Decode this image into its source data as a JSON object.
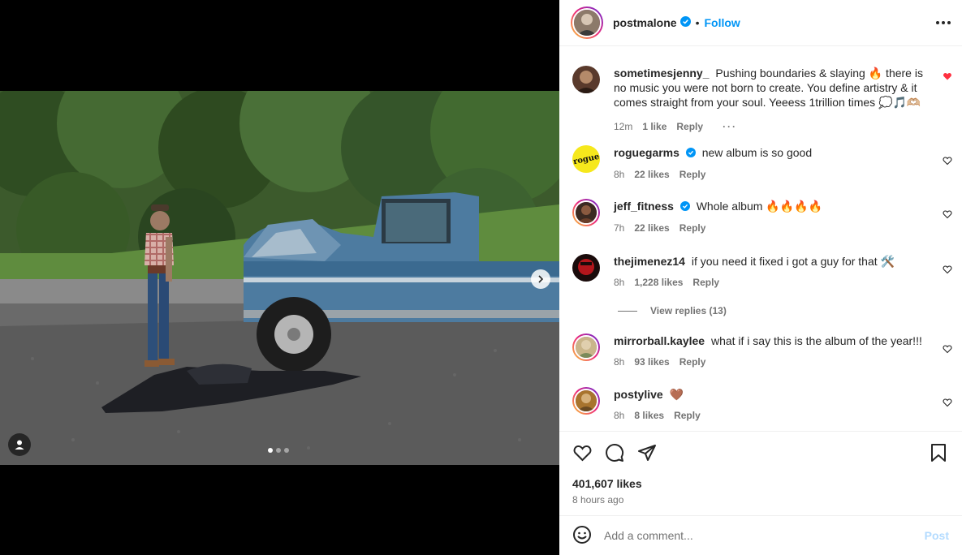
{
  "post": {
    "username": "postmalone",
    "separator": "•",
    "follow_label": "Follow",
    "carousel": {
      "slide_count": 3,
      "active_slide": 1
    }
  },
  "comments": [
    {
      "username": "sometimesjenny_",
      "text": "Pushing boundaries & slaying 🔥 there is no music you were not born to create. You define artistry & it comes straight from your soul. Yeeess 1trillion times 💭🎵🫶🏼",
      "time": "12m",
      "likes": "1 like",
      "reply_label": "Reply",
      "liked": true
    },
    {
      "username": "roguegarms",
      "verified": true,
      "text": "new album is so good",
      "time": "8h",
      "likes": "22 likes",
      "reply_label": "Reply",
      "avatar_text": "rogue"
    },
    {
      "username": "jeff_fitness",
      "verified": true,
      "text": "Whole album 🔥🔥🔥🔥",
      "time": "7h",
      "likes": "22 likes",
      "reply_label": "Reply"
    },
    {
      "username": "thejimenez14",
      "text": "if you need it fixed i got a guy for that 🛠️",
      "time": "8h",
      "likes": "1,228 likes",
      "reply_label": "Reply"
    },
    {
      "username": "mirrorball.kaylee",
      "text": "what if i say this is the album of the year!!!",
      "time": "8h",
      "likes": "93 likes",
      "reply_label": "Reply"
    },
    {
      "username": "postylive",
      "text": "🤎",
      "time": "8h",
      "likes": "8 likes",
      "reply_label": "Reply"
    }
  ],
  "view_replies": "View replies (13)",
  "likes_count": "401,607 likes",
  "posted_time": "8 hours ago",
  "add_comment": {
    "placeholder": "Add a comment...",
    "post_label": "Post"
  },
  "colors": {
    "accent": "#0095f6",
    "liked_heart": "#ff3040",
    "post_disabled": "#b3dbff"
  }
}
